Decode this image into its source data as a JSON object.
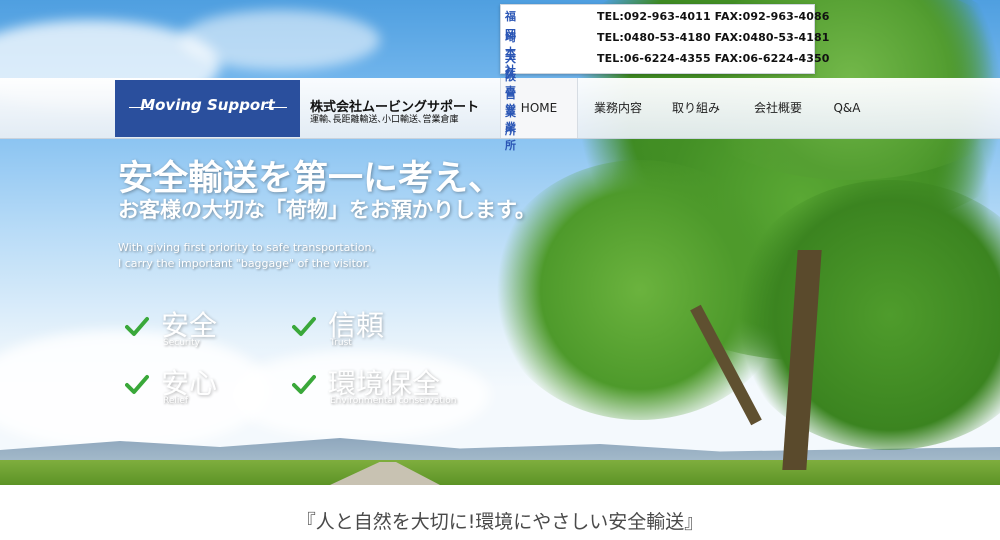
{
  "contact": {
    "offices": [
      {
        "name": "福岡本社",
        "numbers": "TEL:092-963-4011 FAX:092-963-4086"
      },
      {
        "name": "埼玉久喜営業所",
        "numbers": "TEL:0480-53-4180 FAX:0480-53-4181"
      },
      {
        "name": "大阪営業所",
        "numbers": "TEL:06-6224-4355 FAX:06-6224-4350"
      }
    ]
  },
  "logo": {
    "text": "Moving Support",
    "color": "#2a4f9d"
  },
  "company": {
    "name": "株式会社ムービングサポート",
    "tagline": "運輸､長距離輸送､小口輸送､営業倉庫"
  },
  "nav": {
    "items": [
      {
        "label": "HOME"
      },
      {
        "label": "業務内容"
      },
      {
        "label": "取り組み"
      },
      {
        "label": "会社概要"
      },
      {
        "label": "Q&A"
      }
    ]
  },
  "hero": {
    "headline1": "安全輸送を第一に考え、",
    "headline2": "お客様の大切な「荷物」をお預かりします。",
    "sub1": "With giving first priority to safe transportation,",
    "sub2": "I carry the important \"baggage\" of the visitor.",
    "features": [
      {
        "jp": "安全",
        "en": "Security"
      },
      {
        "jp": "信頼",
        "en": "Trust"
      },
      {
        "jp": "安心",
        "en": "Relief"
      },
      {
        "jp": "環境保全",
        "en": "Environmental conservation"
      }
    ],
    "check_color": "#3aa83a"
  },
  "slogan": "『人と自然を大切に!環境にやさしい安全輸送』"
}
